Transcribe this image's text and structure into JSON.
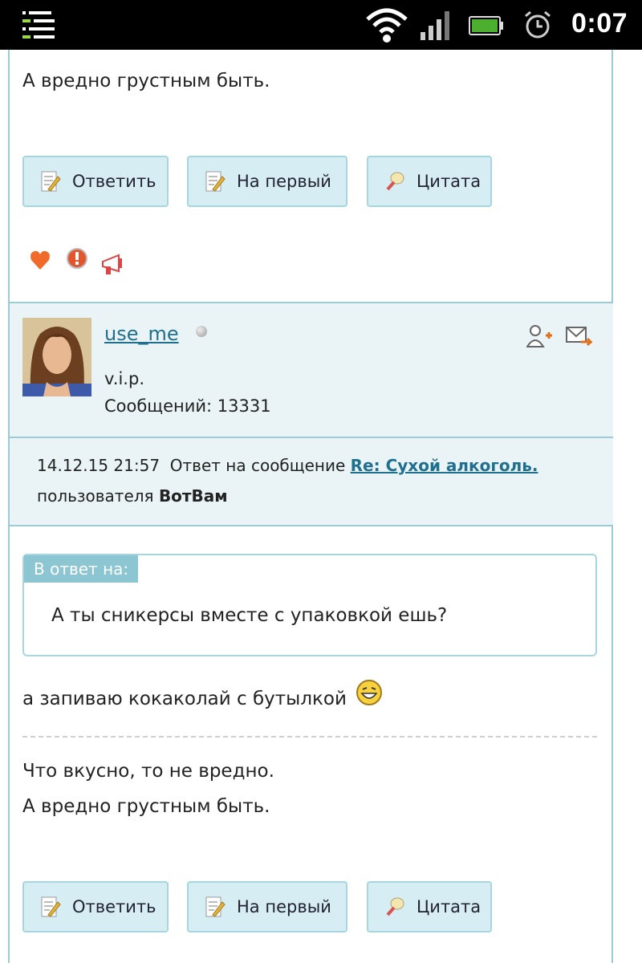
{
  "status_bar": {
    "time": "0:07",
    "icons": [
      "notifications-icon",
      "wifi-icon",
      "signal-icon",
      "battery-icon",
      "alarm-icon"
    ]
  },
  "prev_post": {
    "signature_line": "А вредно грустным быть.",
    "buttons": {
      "reply": "Ответить",
      "to_first": "На первый",
      "quote": "Цитата"
    },
    "action_icons": [
      "heart-icon",
      "warning-icon",
      "megaphone-icon"
    ]
  },
  "author": {
    "username": "use_me",
    "role": "v.i.p.",
    "messages_count": "Сообщений: 13331"
  },
  "reply_info": {
    "datetime": "14.12.15 21:57",
    "text_before": "Ответ на сообщение",
    "topic_link": "Re: Сухой алкоголь.",
    "text_user": "пользователя",
    "user": "ВотВам"
  },
  "post": {
    "quote_label": "В ответ на:",
    "quote_text": "А ты сникерсы вместе с упаковкой ешь?",
    "body": "а запиваю кокаколай с бутылкой",
    "signature_line1": "Что вкусно, то не вредно.",
    "signature_line2": "А вредно грустным быть.",
    "buttons": {
      "reply": "Ответить",
      "to_first": "На первый",
      "quote": "Цитата"
    }
  },
  "colors": {
    "accent": "#1f6f8f",
    "panel_bg": "#eaf4f6",
    "button_bg": "#d6eef3",
    "border": "#9ccbd4"
  }
}
